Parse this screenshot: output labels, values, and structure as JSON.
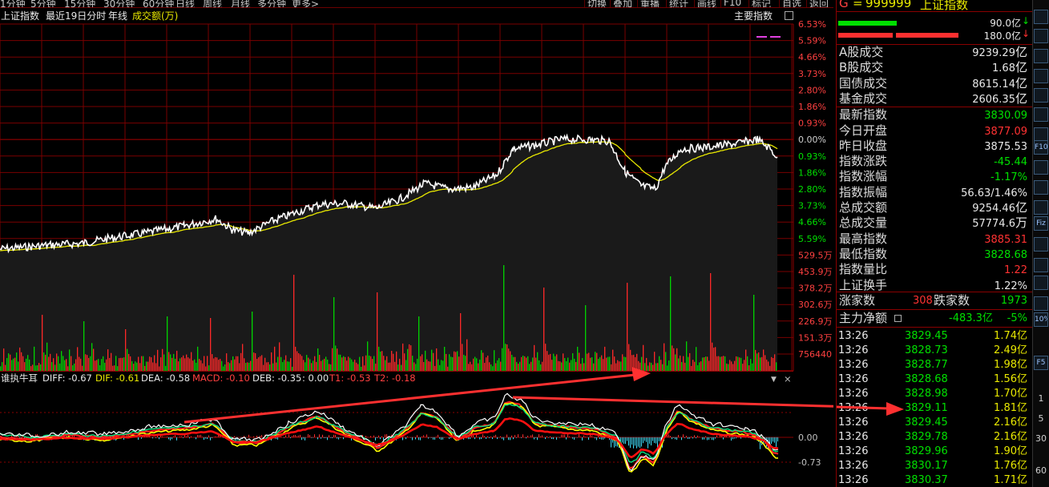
{
  "toolbar": {
    "periods": [
      "1分钟",
      "5分钟",
      "15分钟",
      "30分钟",
      "60分钟",
      "日线",
      "周线",
      "月线",
      "多分钟",
      "更多>"
    ],
    "right_buttons": [
      "切换",
      "叠加",
      "重播",
      "统计",
      "画线",
      "F10",
      "标记",
      "自选",
      "返回"
    ]
  },
  "chart_header": {
    "index_name": "上证指数",
    "mode": "最近19日分时",
    "line_label": "年线",
    "volume_label": "成交额(万)",
    "main_index_button": "主要指数"
  },
  "price_axis": {
    "up_labels": [
      "6.53%",
      "5.59%",
      "4.66%",
      "3.73%",
      "2.80%",
      "1.86%",
      "0.93%"
    ],
    "zero_label": "0.00%",
    "down_labels": [
      "0.93%",
      "1.86%",
      "2.80%",
      "3.73%",
      "4.66%",
      "5.59%"
    ]
  },
  "volume_axis": {
    "labels": [
      "529.5万",
      "453.9万",
      "378.2万",
      "302.6万",
      "226.9万",
      "151.3万",
      "756440"
    ]
  },
  "indicator": {
    "name": "谁执牛耳",
    "diff": "DIFF: -0.67",
    "dif": "DIF: -0.61",
    "dea": "DEA: -0.58",
    "macd": "MACD: -0.10",
    "deb": "DEB: -0.35",
    "extra": ": 0.00",
    "t1": "T1: -0.53",
    "t2": "T2: -0.18",
    "axis_labels": [
      "0.00",
      "-0.73"
    ],
    "dropdown_glyph": "▼",
    "close_glyph": "×"
  },
  "right_panel": {
    "code_prefix": "G",
    "code": "999999",
    "name": "上证指数",
    "flow_in": "90.0亿",
    "flow_out": "180.0亿",
    "stats": [
      {
        "label": "A股成交",
        "value": "9239.29",
        "unit": "亿",
        "color": "#e8e8e8"
      },
      {
        "label": "B股成交",
        "value": "1.68",
        "unit": "亿",
        "color": "#e8e8e8"
      },
      {
        "label": "国债成交",
        "value": "8615.14",
        "unit": "亿",
        "color": "#e8e8e8"
      },
      {
        "label": "基金成交",
        "value": "2606.35",
        "unit": "亿",
        "color": "#e8e8e8"
      },
      {
        "label": "最新指数",
        "value": "3830.09",
        "unit": "",
        "color": "#00e000"
      },
      {
        "label": "今日开盘",
        "value": "3877.09",
        "unit": "",
        "color": "#ff3232"
      },
      {
        "label": "昨日收盘",
        "value": "3875.53",
        "unit": "",
        "color": "#e8e8e8"
      },
      {
        "label": "指数涨跌",
        "value": "-45.44",
        "unit": "",
        "color": "#00e000"
      },
      {
        "label": "指数涨幅",
        "value": "-1.17%",
        "unit": "",
        "color": "#00e000"
      },
      {
        "label": "指数振幅",
        "value": "56.63/1.46%",
        "unit": "",
        "color": "#e8e8e8"
      },
      {
        "label": "总成交额",
        "value": "9254.46",
        "unit": "亿",
        "color": "#e8e8e8"
      },
      {
        "label": "总成交量",
        "value": "57774.6",
        "unit": "万",
        "color": "#e8e8e8"
      },
      {
        "label": "最高指数",
        "value": "3885.31",
        "unit": "",
        "color": "#ff3232"
      },
      {
        "label": "最低指数",
        "value": "3828.68",
        "unit": "",
        "color": "#00e000"
      },
      {
        "label": "指数量比",
        "value": "1.22",
        "unit": "",
        "color": "#ff3232"
      },
      {
        "label": "上证换手",
        "value": "1.22%",
        "unit": "",
        "color": "#e8e8e8"
      }
    ],
    "advance_label": "涨家数",
    "advance_value": "308",
    "decline_label": "跌家数",
    "decline_value": "1973",
    "main_flow_label": "主力净额",
    "main_flow_value": "-483.3亿",
    "main_flow_pct": "-5%",
    "ticks": [
      {
        "time": "13:26",
        "price": "3829.45",
        "amount": "1.74亿"
      },
      {
        "time": "13:26",
        "price": "3828.73",
        "amount": "2.49亿"
      },
      {
        "time": "13:26",
        "price": "3828.77",
        "amount": "1.98亿"
      },
      {
        "time": "13:26",
        "price": "3828.68",
        "amount": "1.56亿"
      },
      {
        "time": "13:26",
        "price": "3828.98",
        "amount": "1.70亿"
      },
      {
        "time": "13:26",
        "price": "3829.11",
        "amount": "1.81亿"
      },
      {
        "time": "13:26",
        "price": "3829.45",
        "amount": "2.16亿"
      },
      {
        "time": "13:26",
        "price": "3829.78",
        "amount": "2.16亿"
      },
      {
        "time": "13:26",
        "price": "3829.96",
        "amount": "1.90亿"
      },
      {
        "time": "13:26",
        "price": "3830.17",
        "amount": "1.76亿"
      },
      {
        "time": "13:26",
        "price": "3830.37",
        "amount": "1.71亿"
      }
    ]
  },
  "side_tools": [
    "F10",
    "Fiz",
    "10%",
    "F5",
    "1",
    "5",
    "30",
    "60"
  ],
  "colors": {
    "up": "#ff3232",
    "down": "#00e000",
    "grid": "#7a0000",
    "price_line": "#ffffff",
    "avg_line": "#e8e800",
    "axis_text": "#ff4040",
    "annotation": "#ff3030"
  }
}
